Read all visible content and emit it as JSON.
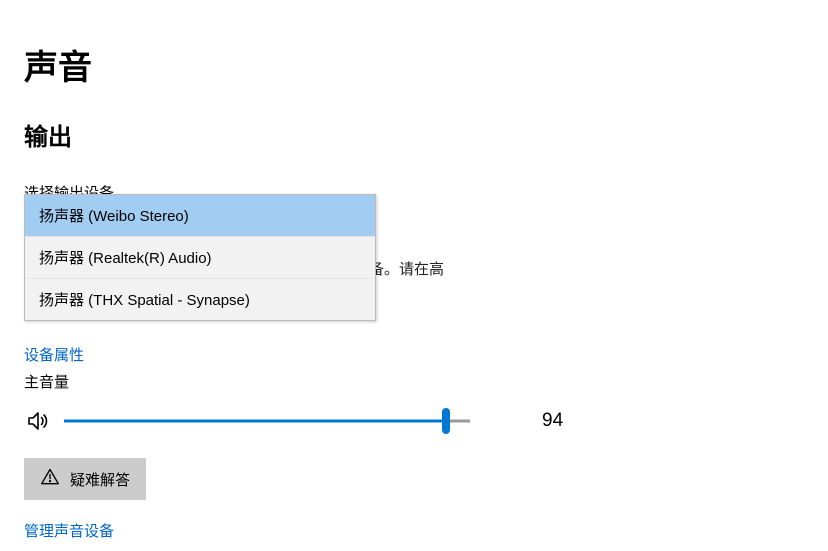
{
  "page_title": "声音",
  "output": {
    "section_title": "输出",
    "select_label": "选择输出设备",
    "dropdown_items": [
      "扬声器 (Weibo Stereo)",
      "扬声器 (Realtek(R) Audio)",
      "扬声器 (THX Spatial - Synapse)"
    ],
    "hint_visible_fragment": "备不同的声音设备。请在高",
    "device_properties_link": "设备属性",
    "master_volume_label": "主音量",
    "volume_value": "94",
    "volume_pct": 94,
    "troubleshoot_label": "疑难解答",
    "manage_devices_link": "管理声音设备"
  }
}
